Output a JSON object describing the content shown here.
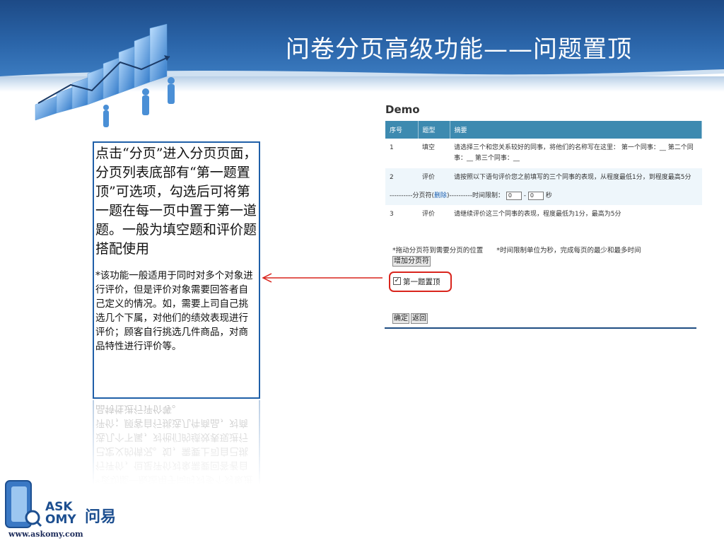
{
  "slide": {
    "title": "问卷分页高级功能——问题置顶"
  },
  "description": {
    "main": "点击“分页”进入分页页面，分页列表底部有“第一题置顶”可选项，勾选后可将第一题在每一页中置于第一道题。一般为填空题和评价题搭配使用",
    "note": "*该功能一般适用于同时对多个对象进行评价，但是评价对象需要回答者自己定义的情况。如，需要上司自己挑选几个下属，对他们的绩效表现进行评价；顾客自行挑选几件商品，对商品特性进行评价等。"
  },
  "demo": {
    "title": "Demo",
    "columns": [
      "序号",
      "题型",
      "摘要"
    ],
    "rows": [
      {
        "no": "1",
        "type": "填空",
        "summary": "请选择三个和您关系较好的同事，将他们的名称写在这里： 第一个同事：__ 第二个同事：__ 第三个同事：__"
      },
      {
        "no": "2",
        "type": "评价",
        "summary": "请按照以下语句评价您之前填写的三个同事的表现，从程度最低1分，到程度最高5分"
      },
      {
        "no": "3",
        "type": "评价",
        "summary": "请继续评价这三个同事的表现，程度最低为1分，最高为5分"
      }
    ],
    "pager": {
      "prefix": "----------分页符(",
      "delete_link": "删除",
      "middle": ")----------时间限制：",
      "min_value": "0",
      "dash": "-",
      "max_value": "0",
      "unit": "秒"
    },
    "hint": "*拖动分页符到需要分页的位置　　*时间限制单位为秒，完成每页的最少和最多时间",
    "add_pager_button": "增加分页符",
    "checkbox_label": "第一题置顶",
    "checkbox_checked": true,
    "ok_button": "确定",
    "back_button": "返回"
  },
  "logo": {
    "line1": "ASK",
    "line2": "OMY",
    "brand_cn": "问易",
    "url": "www.askomy.com"
  },
  "colors": {
    "header": "#2a64a8",
    "table_header": "#3d8ab0",
    "highlight_border": "#d9251d",
    "arrow": "#d9251d"
  }
}
